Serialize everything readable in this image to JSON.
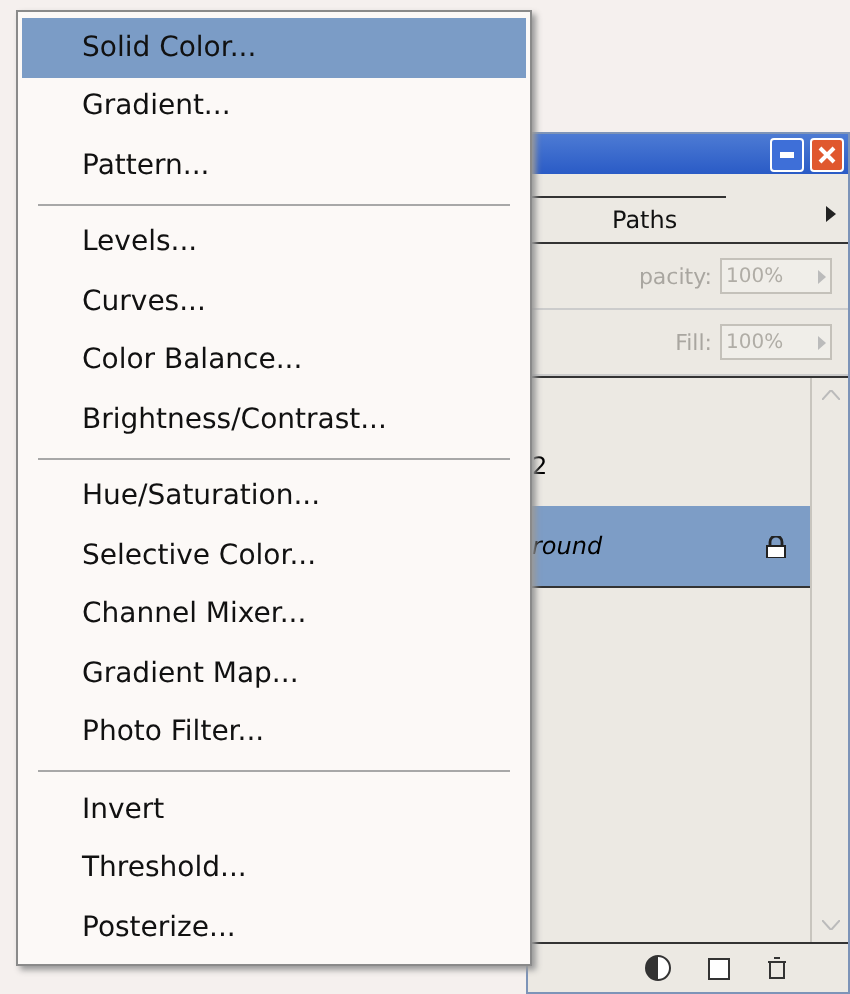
{
  "menu": {
    "groups": [
      [
        {
          "label": "Solid Color...",
          "selected": true
        },
        {
          "label": "Gradient...",
          "selected": false
        },
        {
          "label": "Pattern...",
          "selected": false
        }
      ],
      [
        {
          "label": "Levels...",
          "selected": false
        },
        {
          "label": "Curves...",
          "selected": false
        },
        {
          "label": "Color Balance...",
          "selected": false
        },
        {
          "label": "Brightness/Contrast...",
          "selected": false
        }
      ],
      [
        {
          "label": "Hue/Saturation...",
          "selected": false
        },
        {
          "label": "Selective Color...",
          "selected": false
        },
        {
          "label": "Channel Mixer...",
          "selected": false
        },
        {
          "label": "Gradient Map...",
          "selected": false
        },
        {
          "label": "Photo Filter...",
          "selected": false
        }
      ],
      [
        {
          "label": "Invert",
          "selected": false
        },
        {
          "label": "Threshold...",
          "selected": false
        },
        {
          "label": "Posterize...",
          "selected": false
        }
      ]
    ]
  },
  "panel": {
    "tabs": [
      {
        "label": "Paths",
        "selected": false
      }
    ],
    "opacity": {
      "label": "pacity:",
      "value": "100%",
      "disabled": true
    },
    "fill": {
      "label": "Fill:",
      "value": "100%",
      "disabled": true
    },
    "layers": [
      {
        "name": "2",
        "selected": false,
        "locked": false
      },
      {
        "name": "round",
        "selected": true,
        "locked": true
      }
    ]
  }
}
